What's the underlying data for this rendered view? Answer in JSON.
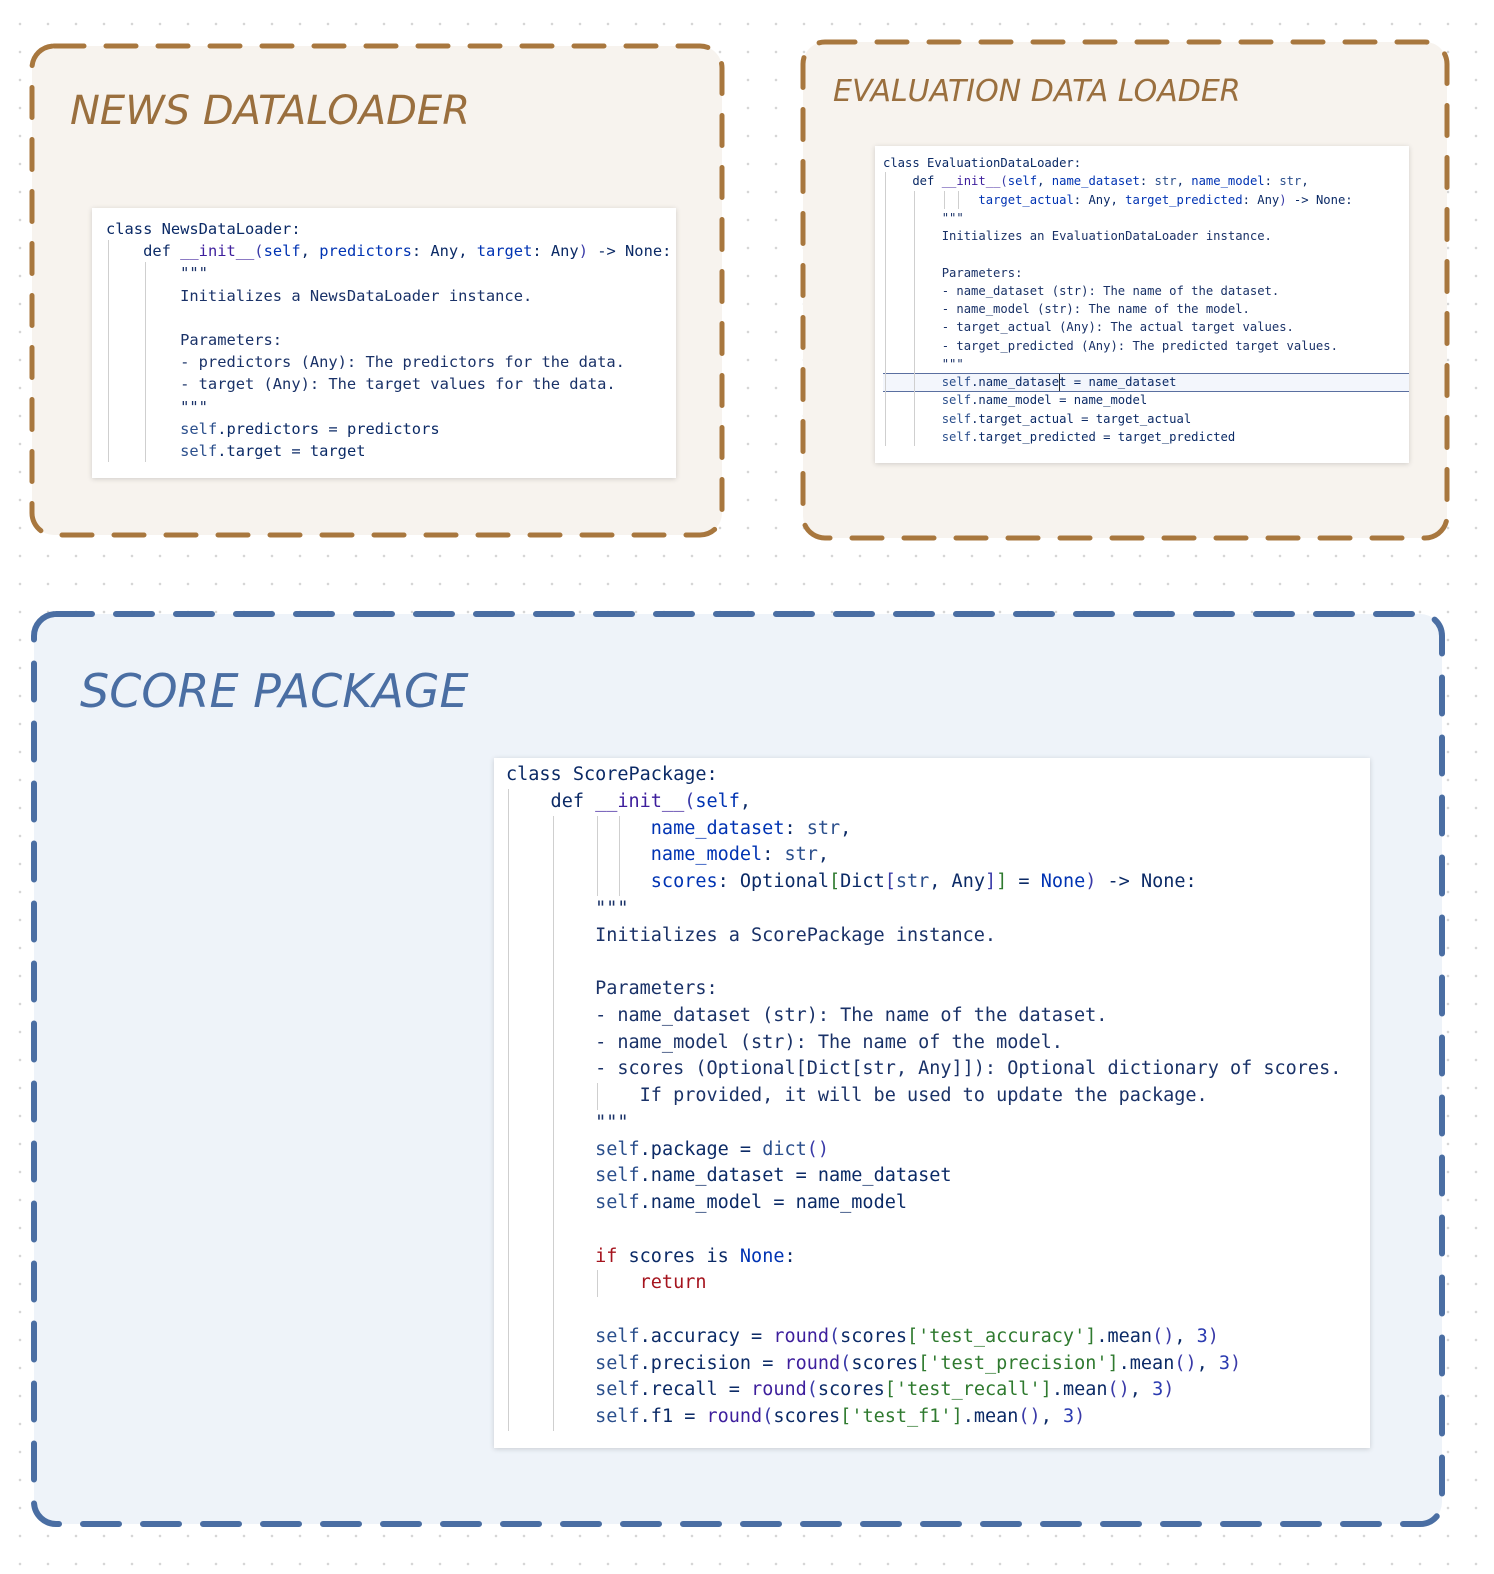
{
  "frames": {
    "news": {
      "title": "NEWS DATALOADER",
      "code": [
        [
          [
            "class NewsDataLoader:",
            "k"
          ]
        ],
        [
          [
            "    def ",
            "k"
          ],
          [
            "__init__",
            "fn"
          ],
          [
            "(",
            "br"
          ],
          [
            "self",
            "kw"
          ],
          [
            ", ",
            "k"
          ],
          [
            "predictors",
            "kw"
          ],
          [
            ": Any, ",
            "k"
          ],
          [
            "target",
            "kw"
          ],
          [
            ": Any",
            "k"
          ],
          [
            ")",
            "br"
          ],
          [
            " -> None:",
            "k"
          ]
        ],
        [
          [
            "        \"\"\"",
            "doc"
          ]
        ],
        [
          [
            "        Initializes a NewsDataLoader instance.",
            "doc"
          ]
        ],
        [
          [
            "",
            "doc"
          ]
        ],
        [
          [
            "        Parameters:",
            "doc"
          ]
        ],
        [
          [
            "        - predictors (Any): The predictors for the data.",
            "doc"
          ]
        ],
        [
          [
            "        - target (Any): The target values for the data.",
            "doc"
          ]
        ],
        [
          [
            "        \"\"\"",
            "doc"
          ]
        ],
        [
          [
            "        ",
            "k"
          ],
          [
            "self",
            "slf"
          ],
          [
            ".predictors = predictors",
            "k"
          ]
        ],
        [
          [
            "        ",
            "k"
          ],
          [
            "self",
            "slf"
          ],
          [
            ".target = target",
            "k"
          ]
        ]
      ]
    },
    "evaluation": {
      "title": "EVALUATION DATA LOADER",
      "code": [
        [
          [
            "class EvaluationDataLoader:",
            "k"
          ]
        ],
        [
          [
            "    def ",
            "k"
          ],
          [
            "__init__",
            "fn"
          ],
          [
            "(",
            "br"
          ],
          [
            "self",
            "kw"
          ],
          [
            ", ",
            "k"
          ],
          [
            "name_dataset",
            "kw"
          ],
          [
            ": ",
            "k"
          ],
          [
            "str",
            "tp"
          ],
          [
            ", ",
            "k"
          ],
          [
            "name_model",
            "kw"
          ],
          [
            ": ",
            "k"
          ],
          [
            "str",
            "tp"
          ],
          [
            ",",
            "k"
          ]
        ],
        [
          [
            "             ",
            "k"
          ],
          [
            "target_actual",
            "kw"
          ],
          [
            ": Any, ",
            "k"
          ],
          [
            "target_predicted",
            "kw"
          ],
          [
            ": Any",
            "k"
          ],
          [
            ")",
            "br"
          ],
          [
            " -> None:",
            "k"
          ]
        ],
        [
          [
            "        \"\"\"",
            "doc"
          ]
        ],
        [
          [
            "        Initializes an EvaluationDataLoader instance.",
            "doc"
          ]
        ],
        [
          [
            "",
            "doc"
          ]
        ],
        [
          [
            "        Parameters:",
            "doc"
          ]
        ],
        [
          [
            "        - name_dataset (str): The name of the dataset.",
            "doc"
          ]
        ],
        [
          [
            "        - name_model (str): The name of the model.",
            "doc"
          ]
        ],
        [
          [
            "        - target_actual (Any): The actual target values.",
            "doc"
          ]
        ],
        [
          [
            "        - target_predicted (Any): The predicted target values.",
            "doc"
          ]
        ],
        [
          [
            "        \"\"\"",
            "doc"
          ]
        ],
        [
          [
            "        ",
            "k"
          ],
          [
            "self",
            "slf"
          ],
          [
            ".name_dataset = name_dataset",
            "k"
          ]
        ],
        [
          [
            "        ",
            "k"
          ],
          [
            "self",
            "slf"
          ],
          [
            ".name_model = name_model",
            "k"
          ]
        ],
        [
          [
            "        ",
            "k"
          ],
          [
            "self",
            "slf"
          ],
          [
            ".target_actual = target_actual",
            "k"
          ]
        ],
        [
          [
            "        ",
            "k"
          ],
          [
            "self",
            "slf"
          ],
          [
            ".target_predicted = target_predicted",
            "k"
          ]
        ]
      ]
    },
    "score": {
      "title": "SCORE PACKAGE",
      "code": [
        [
          [
            "class ScorePackage:",
            "k"
          ]
        ],
        [
          [
            "    def ",
            "k"
          ],
          [
            "__init__",
            "fn"
          ],
          [
            "(",
            "br"
          ],
          [
            "self",
            "kw"
          ],
          [
            ",",
            "k"
          ]
        ],
        [
          [
            "             ",
            "k"
          ],
          [
            "name_dataset",
            "kw"
          ],
          [
            ": ",
            "k"
          ],
          [
            "str",
            "tp"
          ],
          [
            ",",
            "k"
          ]
        ],
        [
          [
            "             ",
            "k"
          ],
          [
            "name_model",
            "kw"
          ],
          [
            ": ",
            "k"
          ],
          [
            "str",
            "tp"
          ],
          [
            ",",
            "k"
          ]
        ],
        [
          [
            "             ",
            "k"
          ],
          [
            "scores",
            "kw"
          ],
          [
            ": Optional",
            "k"
          ],
          [
            "[",
            "str"
          ],
          [
            "Dict",
            "k"
          ],
          [
            "[",
            "br"
          ],
          [
            "str",
            "tp"
          ],
          [
            ", Any",
            "k"
          ],
          [
            "]",
            "br"
          ],
          [
            "]",
            "str"
          ],
          [
            " = ",
            "k"
          ],
          [
            "None",
            "kw"
          ],
          [
            ")",
            "br"
          ],
          [
            " -> None:",
            "k"
          ]
        ],
        [
          [
            "        \"\"\"",
            "doc"
          ]
        ],
        [
          [
            "        Initializes a ScorePackage instance.",
            "doc"
          ]
        ],
        [
          [
            "",
            "doc"
          ]
        ],
        [
          [
            "        Parameters:",
            "doc"
          ]
        ],
        [
          [
            "        - name_dataset (str): The name of the dataset.",
            "doc"
          ]
        ],
        [
          [
            "        - name_model (str): The name of the model.",
            "doc"
          ]
        ],
        [
          [
            "        - scores (Optional[Dict[str, Any]]): Optional dictionary of scores.",
            "doc"
          ]
        ],
        [
          [
            "            If provided, it will be used to update the package.",
            "doc"
          ]
        ],
        [
          [
            "        \"\"\"",
            "doc"
          ]
        ],
        [
          [
            "        ",
            "k"
          ],
          [
            "self",
            "slf"
          ],
          [
            ".package = ",
            "k"
          ],
          [
            "dict",
            "tp"
          ],
          [
            "()",
            "br"
          ]
        ],
        [
          [
            "        ",
            "k"
          ],
          [
            "self",
            "slf"
          ],
          [
            ".name_dataset = name_dataset",
            "k"
          ]
        ],
        [
          [
            "        ",
            "k"
          ],
          [
            "self",
            "slf"
          ],
          [
            ".name_model = name_model",
            "k"
          ]
        ],
        [
          [
            "",
            "k"
          ]
        ],
        [
          [
            "        ",
            "k"
          ],
          [
            "if",
            "red"
          ],
          [
            " scores ",
            "k"
          ],
          [
            "is",
            "k"
          ],
          [
            " ",
            "k"
          ],
          [
            "None",
            "kw"
          ],
          [
            ":",
            "k"
          ]
        ],
        [
          [
            "            ",
            "k"
          ],
          [
            "return",
            "red"
          ]
        ],
        [
          [
            "",
            "k"
          ]
        ],
        [
          [
            "        ",
            "k"
          ],
          [
            "self",
            "slf"
          ],
          [
            ".accuracy = ",
            "k"
          ],
          [
            "round",
            "fn"
          ],
          [
            "(",
            "br"
          ],
          [
            "scores",
            "k"
          ],
          [
            "[",
            "str"
          ],
          [
            "'test_accuracy'",
            "str"
          ],
          [
            "]",
            "str"
          ],
          [
            ".mean",
            "k"
          ],
          [
            "()",
            "br"
          ],
          [
            ", ",
            "k"
          ],
          [
            "3",
            "num"
          ],
          [
            ")",
            "br"
          ]
        ],
        [
          [
            "        ",
            "k"
          ],
          [
            "self",
            "slf"
          ],
          [
            ".precision = ",
            "k"
          ],
          [
            "round",
            "fn"
          ],
          [
            "(",
            "br"
          ],
          [
            "scores",
            "k"
          ],
          [
            "[",
            "str"
          ],
          [
            "'test_precision'",
            "str"
          ],
          [
            "]",
            "str"
          ],
          [
            ".mean",
            "k"
          ],
          [
            "()",
            "br"
          ],
          [
            ", ",
            "k"
          ],
          [
            "3",
            "num"
          ],
          [
            ")",
            "br"
          ]
        ],
        [
          [
            "        ",
            "k"
          ],
          [
            "self",
            "slf"
          ],
          [
            ".recall = ",
            "k"
          ],
          [
            "round",
            "fn"
          ],
          [
            "(",
            "br"
          ],
          [
            "scores",
            "k"
          ],
          [
            "[",
            "str"
          ],
          [
            "'test_recall'",
            "str"
          ],
          [
            "]",
            "str"
          ],
          [
            ".mean",
            "k"
          ],
          [
            "()",
            "br"
          ],
          [
            ", ",
            "k"
          ],
          [
            "3",
            "num"
          ],
          [
            ")",
            "br"
          ]
        ],
        [
          [
            "        ",
            "k"
          ],
          [
            "self",
            "slf"
          ],
          [
            ".f1 = ",
            "k"
          ],
          [
            "round",
            "fn"
          ],
          [
            "(",
            "br"
          ],
          [
            "scores",
            "k"
          ],
          [
            "[",
            "str"
          ],
          [
            "'test_f1'",
            "str"
          ],
          [
            "]",
            "str"
          ],
          [
            ".mean",
            "k"
          ],
          [
            "()",
            "br"
          ],
          [
            ", ",
            "k"
          ],
          [
            "3",
            "num"
          ],
          [
            ")",
            "br"
          ]
        ]
      ]
    }
  },
  "colors": {
    "brown_border": "#a8773e",
    "brown_fill": "#f7f3ee",
    "brown_title": "#9a6f3e",
    "blue_border": "#4a6ea3",
    "blue_fill": "#eef3f9",
    "blue_title": "#4a6ea3"
  }
}
